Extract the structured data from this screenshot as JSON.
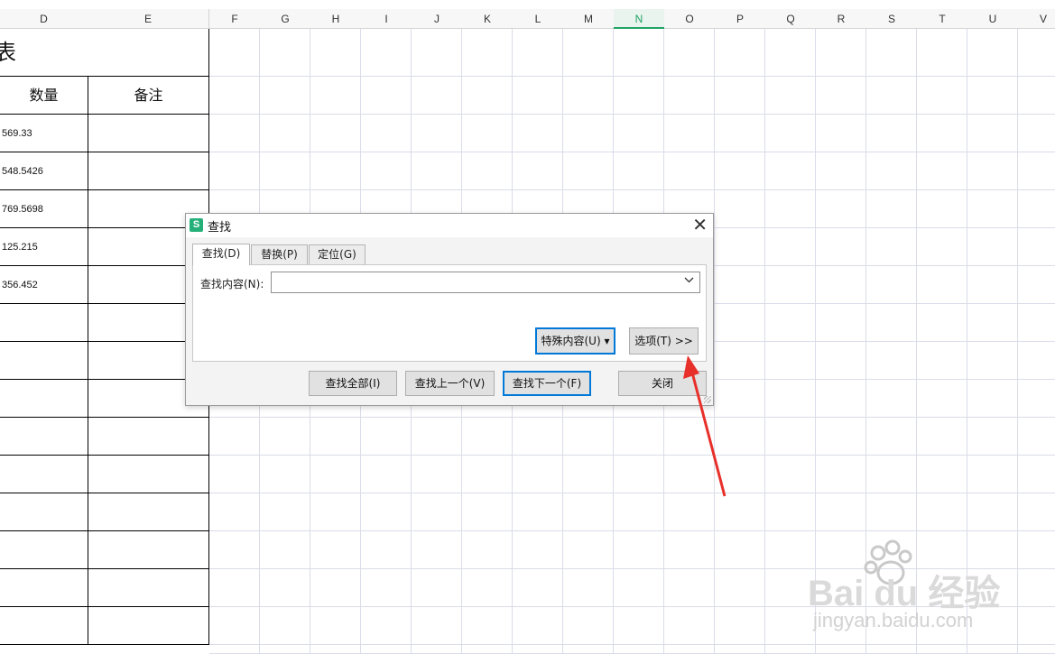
{
  "columns": [
    "D",
    "E",
    "F",
    "G",
    "H",
    "I",
    "J",
    "K",
    "L",
    "M",
    "N",
    "O",
    "P",
    "Q",
    "R",
    "S",
    "T",
    "U",
    "V"
  ],
  "selected_column": "N",
  "table": {
    "title_fragment": "表",
    "headers": [
      "数量",
      "备注"
    ],
    "quantities": [
      "569.33",
      "548.5426",
      "769.5698",
      "125.215",
      "356.452"
    ]
  },
  "dialog": {
    "title": "查找",
    "app_icon_letter": "S",
    "close_glyph": "✕",
    "tabs": [
      "查找(D)",
      "替换(P)",
      "定位(G)"
    ],
    "active_tab": 0,
    "find_label": "查找内容(N):",
    "find_value": "",
    "special_button": "特殊内容(U) ▾",
    "options_button": "选项(T) >>",
    "find_all_button": "查找全部(I)",
    "find_prev_button": "查找上一个(V)",
    "find_next_button": "查找下一个(F)",
    "close_button": "关闭"
  },
  "watermark": {
    "brand": "Bai du 经验",
    "url": "jingyan.baidu.com"
  },
  "colors": {
    "accent": "#21a366",
    "annotation_arrow": "#e8302b"
  }
}
